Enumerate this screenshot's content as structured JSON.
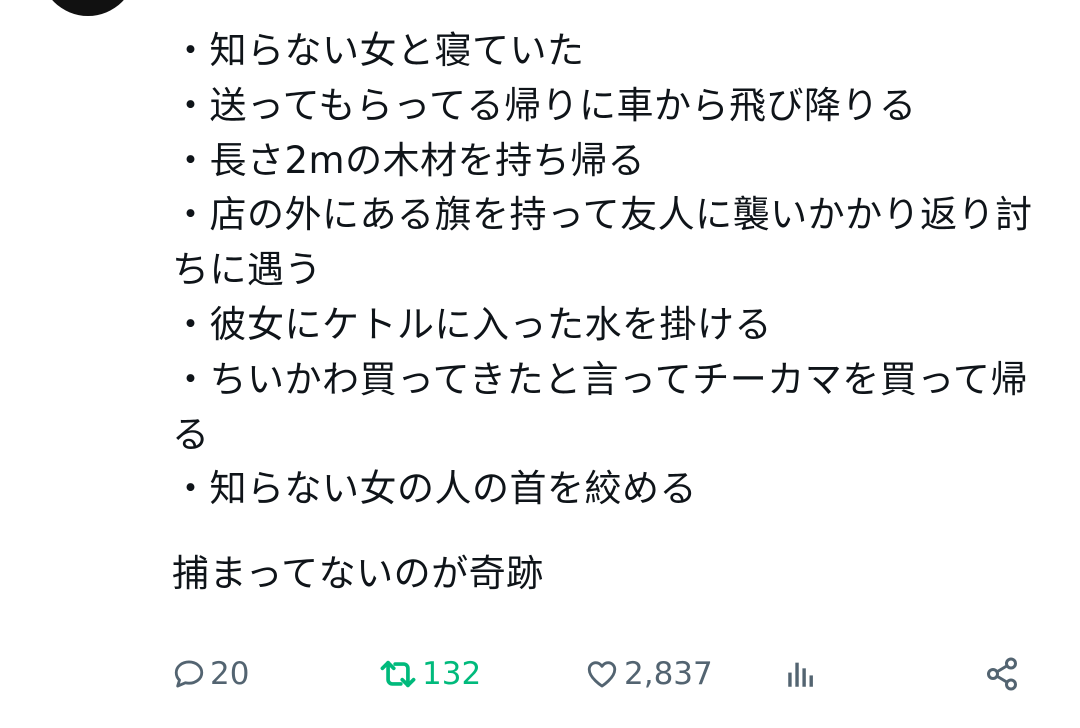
{
  "author": {
    "name": "",
    "handle": ""
  },
  "tweet": {
    "lines": [
      "・知らない女と寝ていた",
      "・送ってもらってる帰りに車から飛び降りる",
      "・長さ2mの木材を持ち帰る",
      "・店の外にある旗を持って友人に襲いかかり返り討ちに遇う",
      "・彼女にケトルに入った水を掛ける",
      "・ちいかわ買ってきたと言ってチーカマを買って帰る",
      "・知らない女の人の首を絞める"
    ],
    "closing": "捕まってないのが奇跡"
  },
  "actions": {
    "reply": {
      "icon": "reply-icon",
      "count": "20"
    },
    "retweet": {
      "icon": "retweet-icon",
      "count": "132",
      "color": "#00ba7c",
      "active": true
    },
    "like": {
      "icon": "heart-icon",
      "count": "2,837"
    },
    "views": {
      "icon": "views-icon"
    },
    "share": {
      "icon": "share-icon"
    }
  },
  "colors": {
    "text": "#0f1419",
    "muted": "#536471",
    "retweet_active": "#00ba7c",
    "link": "#1d9bf0"
  }
}
